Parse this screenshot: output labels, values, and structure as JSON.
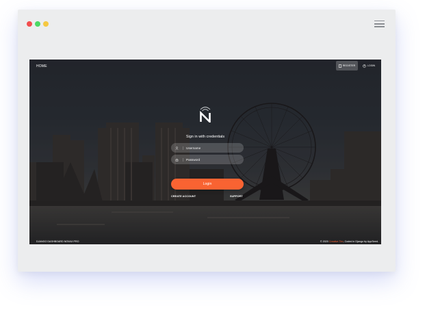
{
  "window": {
    "controls": [
      "close-dot",
      "minimize-dot",
      "maximize-dot"
    ],
    "menu_icon": "hamburger-icon"
  },
  "nav": {
    "home": "HOME",
    "register": "REGISTER",
    "login": "LOGIN"
  },
  "login": {
    "title": "Sign in with credentials",
    "username_placeholder": "Username",
    "password_placeholder": "Password",
    "button": "Login",
    "create_account": "CREATE ACCOUNT",
    "support": "SUPPORT"
  },
  "footer": {
    "left": "DJANGO DASHBOARD NOWUI PRO",
    "right_prefix": "© 2020",
    "right_link": "Creative Tim",
    "right_suffix": ", Coded in Django by AppSeed."
  },
  "colors": {
    "accent": "#f96332",
    "dot_red": "#f24e4e",
    "dot_green": "#4cd964",
    "dot_yellow": "#f5c842"
  }
}
